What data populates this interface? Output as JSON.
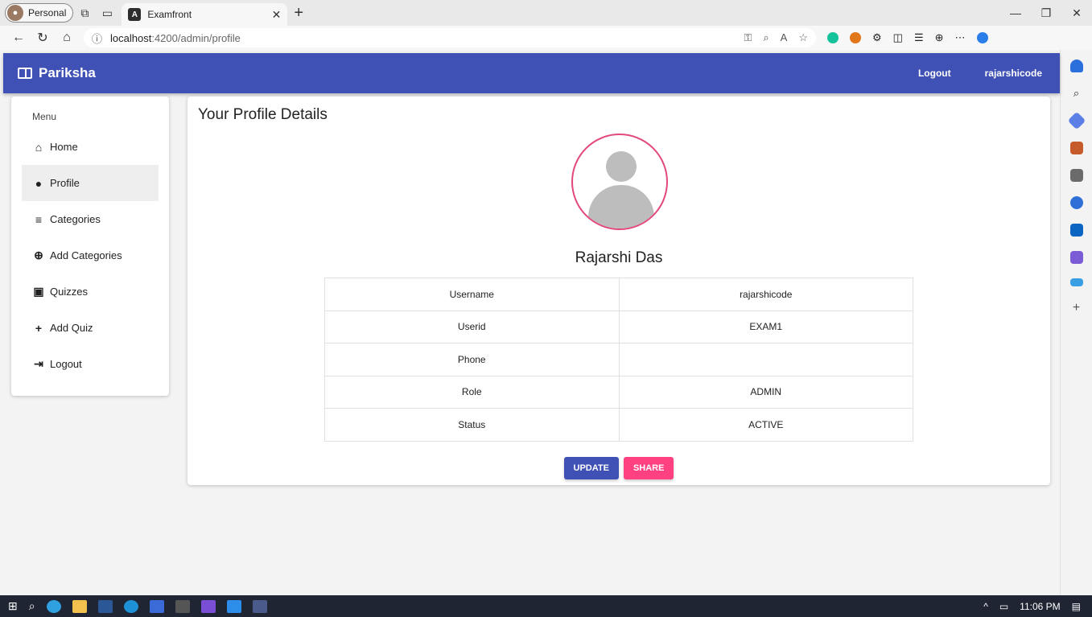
{
  "browser": {
    "profile_label": "Personal",
    "tab_title": "Examfront",
    "url_host": "localhost",
    "url_path": ":4200/admin/profile"
  },
  "app": {
    "brand": "Pariksha",
    "toolbar_logout": "Logout",
    "toolbar_user": "rajarshicode"
  },
  "sidebar": {
    "heading": "Menu",
    "items": [
      {
        "label": "Home",
        "icon": "home-icon"
      },
      {
        "label": "Profile",
        "icon": "account-circle-icon"
      },
      {
        "label": "Categories",
        "icon": "list-icon"
      },
      {
        "label": "Add Categories",
        "icon": "add-circle-icon"
      },
      {
        "label": "Quizzes",
        "icon": "quiz-icon"
      },
      {
        "label": "Add Quiz",
        "icon": "plus-icon"
      },
      {
        "label": "Logout",
        "icon": "logout-icon"
      }
    ]
  },
  "profile": {
    "title": "Your Profile Details",
    "name": "Rajarshi Das",
    "rows": [
      {
        "label": "Username",
        "value": "rajarshicode"
      },
      {
        "label": "Userid",
        "value": "EXAM1"
      },
      {
        "label": "Phone",
        "value": ""
      },
      {
        "label": "Role",
        "value": "ADMIN"
      },
      {
        "label": "Status",
        "value": "ACTIVE"
      }
    ],
    "update_label": "UPDATE",
    "share_label": "SHARE"
  },
  "taskbar": {
    "time": "11:06 PM"
  },
  "colors": {
    "primary": "#3f51b5",
    "accent": "#ff4081",
    "avatar_ring": "#e2487b"
  }
}
